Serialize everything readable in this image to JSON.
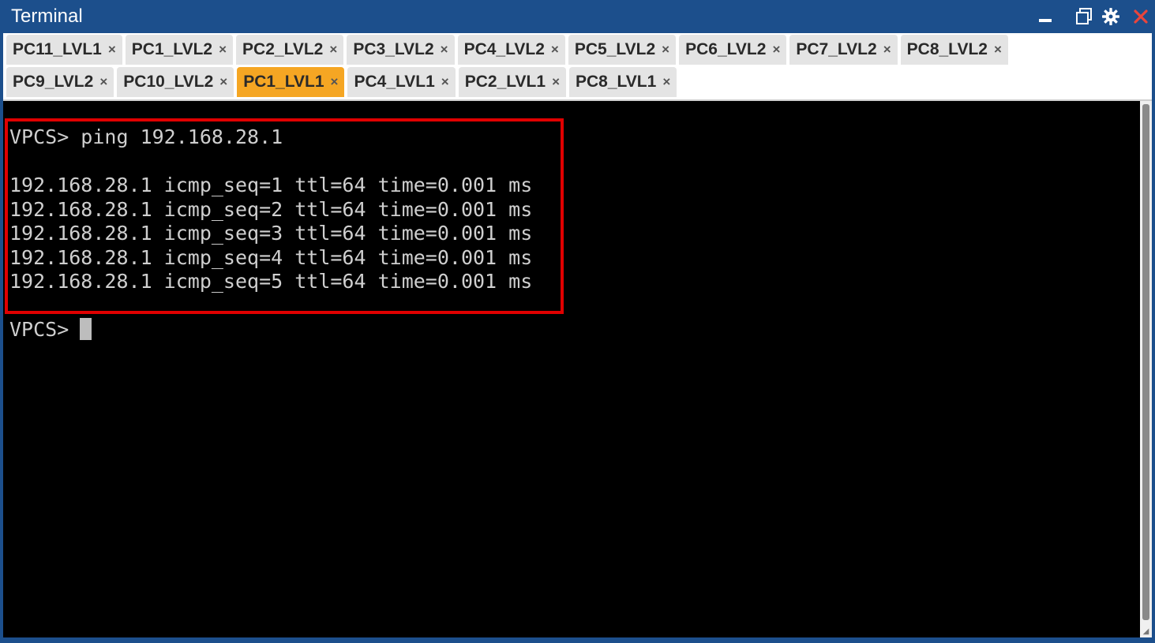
{
  "window": {
    "title": "Terminal",
    "controls": {
      "minimize": "minimize-icon",
      "maximize": "maximize-icon",
      "settings": "gear-icon",
      "close": "close-icon"
    }
  },
  "tabs": {
    "row1": [
      {
        "label": "PC11_LVL1",
        "active": false
      },
      {
        "label": "PC1_LVL2",
        "active": false
      },
      {
        "label": "PC2_LVL2",
        "active": false
      },
      {
        "label": "PC3_LVL2",
        "active": false
      },
      {
        "label": "PC4_LVL2",
        "active": false
      },
      {
        "label": "PC5_LVL2",
        "active": false
      },
      {
        "label": "PC6_LVL2",
        "active": false
      },
      {
        "label": "PC7_LVL2",
        "active": false
      },
      {
        "label": "PC8_LVL2",
        "active": false
      }
    ],
    "row2": [
      {
        "label": "PC9_LVL2",
        "active": false
      },
      {
        "label": "PC10_LVL2",
        "active": false
      },
      {
        "label": "PC1_LVL1",
        "active": true
      },
      {
        "label": "PC4_LVL1",
        "active": false
      },
      {
        "label": "PC2_LVL1",
        "active": false
      },
      {
        "label": "PC8_LVL1",
        "active": false
      }
    ],
    "close_glyph": "×"
  },
  "terminal": {
    "lines": [
      "VPCS> ping 192.168.28.1",
      "",
      "192.168.28.1 icmp_seq=1 ttl=64 time=0.001 ms",
      "192.168.28.1 icmp_seq=2 ttl=64 time=0.001 ms",
      "192.168.28.1 icmp_seq=3 ttl=64 time=0.001 ms",
      "192.168.28.1 icmp_seq=4 ttl=64 time=0.001 ms",
      "192.168.28.1 icmp_seq=5 ttl=64 time=0.001 ms",
      ""
    ],
    "prompt": "VPCS>"
  },
  "colors": {
    "titlebar": "#1c4f8c",
    "active_tab": "#f5a623",
    "highlight_box": "#e00000",
    "terminal_bg": "#000000",
    "terminal_text": "#cfcfcf"
  }
}
